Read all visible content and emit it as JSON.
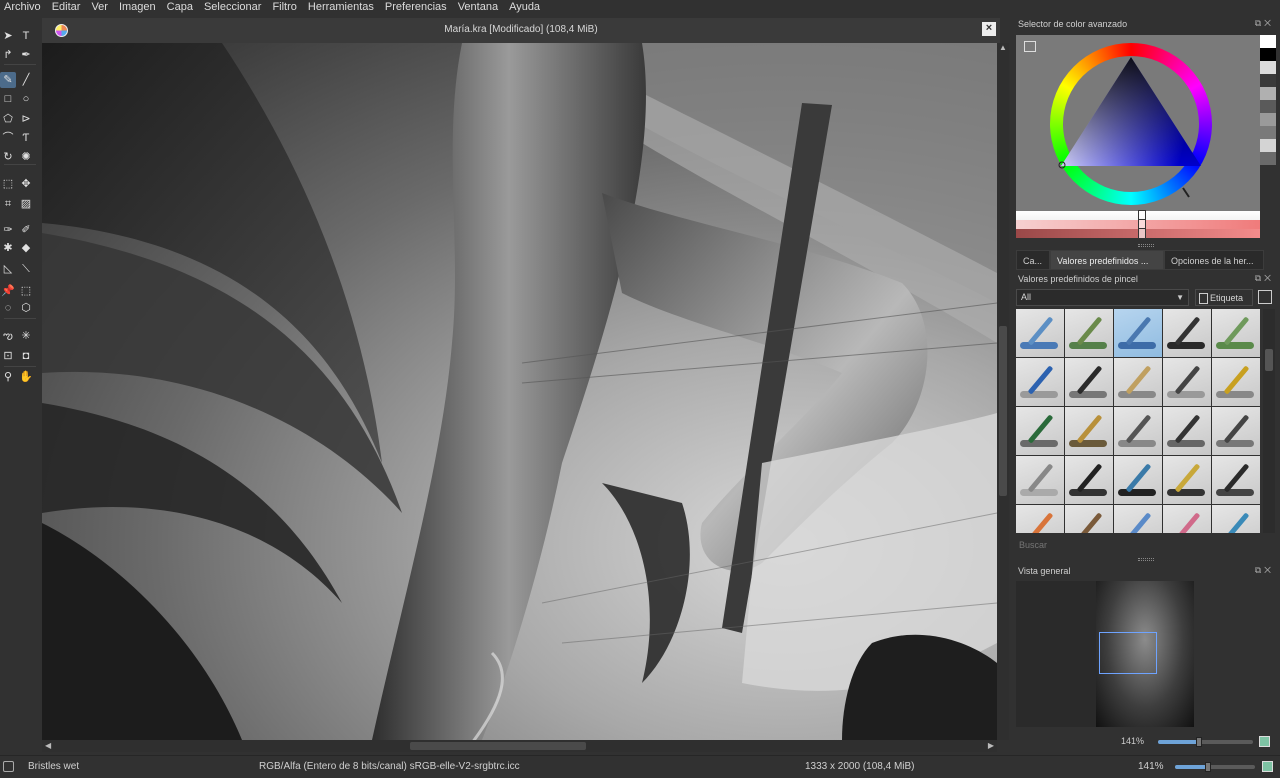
{
  "menu": [
    "Archivo",
    "Editar",
    "Ver",
    "Imagen",
    "Capa",
    "Seleccionar",
    "Filtro",
    "Herramientas",
    "Preferencias",
    "Ventana",
    "Ayuda"
  ],
  "document": {
    "title": "María.kra [Modificado]  (108,4 MiB)",
    "close_label": "×"
  },
  "tools": [
    {
      "name": "select-shape-tool",
      "glyph": "➤"
    },
    {
      "name": "text-tool",
      "glyph": "T"
    },
    {
      "name": "edit-shapes-tool",
      "glyph": "↱"
    },
    {
      "name": "calligraphy-tool",
      "glyph": "✒"
    },
    {
      "name": "freehand-brush-tool",
      "glyph": "✎"
    },
    {
      "name": "line-tool",
      "glyph": "╱"
    },
    {
      "name": "rectangle-tool",
      "glyph": "□"
    },
    {
      "name": "ellipse-tool",
      "glyph": "○"
    },
    {
      "name": "polygon-tool",
      "glyph": "⬠"
    },
    {
      "name": "polyline-tool",
      "glyph": "⊳"
    },
    {
      "name": "bezier-tool",
      "glyph": "⌒"
    },
    {
      "name": "freehand-path-tool",
      "glyph": "Ƭ"
    },
    {
      "name": "dynamic-brush-tool",
      "glyph": "↻"
    },
    {
      "name": "multibrush-tool",
      "glyph": "✺"
    },
    {
      "name": "transform-tool",
      "glyph": "⬚"
    },
    {
      "name": "move-tool",
      "glyph": "✥"
    },
    {
      "name": "crop-tool",
      "glyph": "⌗"
    },
    {
      "name": "gradient-tool",
      "glyph": "▨"
    },
    {
      "name": "color-picker-tool",
      "glyph": "✑"
    },
    {
      "name": "smart-patch-tool",
      "glyph": "✐"
    },
    {
      "name": "fill-tool",
      "glyph": "✱"
    },
    {
      "name": "enclose-fill-tool",
      "glyph": "◆"
    },
    {
      "name": "assistant-tool",
      "glyph": "◺"
    },
    {
      "name": "measure-tool",
      "glyph": "⟍"
    },
    {
      "name": "reference-images-tool",
      "glyph": "📌"
    },
    {
      "name": "rect-select-tool",
      "glyph": "⬚"
    },
    {
      "name": "ellipse-select-tool",
      "glyph": "◌"
    },
    {
      "name": "polygon-select-tool",
      "glyph": "⬡"
    },
    {
      "name": "outline-select-tool",
      "glyph": "ఌ"
    },
    {
      "name": "contiguous-select-tool",
      "glyph": "✳"
    },
    {
      "name": "similar-select-tool",
      "glyph": "⊡"
    },
    {
      "name": "bezier-select-tool",
      "glyph": "◘"
    },
    {
      "name": "zoom-tool",
      "glyph": "⚲"
    },
    {
      "name": "pan-tool",
      "glyph": "✋"
    }
  ],
  "color_panel": {
    "title": "Selector de color avanzado",
    "swatches": [
      "#ffffff",
      "#000000",
      "#dcdcdc",
      "#3a3a3a",
      "#b0b0b0",
      "#5a5a5a",
      "#9a9a9a",
      "#7a7a7a",
      "#d4d4d4",
      "#6a6a6a"
    ]
  },
  "tabs": [
    "Ca...",
    "Valores predefinidos ...",
    "Opciones de la her..."
  ],
  "presets": {
    "title": "Valores predefinidos de pincel",
    "filter_value": "All",
    "tag_label": "Etiqueta",
    "search_placeholder": "Buscar",
    "items": [
      {
        "tip": "#5c8fc4",
        "stroke": "#4a7ab6",
        "selected": false
      },
      {
        "tip": "#6a8a4a",
        "stroke": "#55804a",
        "selected": false
      },
      {
        "tip": "#4a78b0",
        "stroke": "#3d6ca8",
        "selected": true
      },
      {
        "tip": "#333333",
        "stroke": "#2a2a2a",
        "selected": false
      },
      {
        "tip": "#6f9a5c",
        "stroke": "#5a8a4a",
        "selected": false
      },
      {
        "tip": "#2c62b0",
        "stroke": "#9a9a9a",
        "selected": false
      },
      {
        "tip": "#2a2a2a",
        "stroke": "#777777",
        "selected": false
      },
      {
        "tip": "#c0a060",
        "stroke": "#888888",
        "selected": false
      },
      {
        "tip": "#444444",
        "stroke": "#999999",
        "selected": false
      },
      {
        "tip": "#c8a020",
        "stroke": "#888888",
        "selected": false
      },
      {
        "tip": "#2a6a3a",
        "stroke": "#6a6a6a",
        "selected": false
      },
      {
        "tip": "#b8903a",
        "stroke": "#6a5a3a",
        "selected": false
      },
      {
        "tip": "#555555",
        "stroke": "#888888",
        "selected": false
      },
      {
        "tip": "#333333",
        "stroke": "#666666",
        "selected": false
      },
      {
        "tip": "#444444",
        "stroke": "#777777",
        "selected": false
      },
      {
        "tip": "#888888",
        "stroke": "#aaaaaa",
        "selected": false
      },
      {
        "tip": "#222222",
        "stroke": "#333333",
        "selected": false
      },
      {
        "tip": "#3a7aa8",
        "stroke": "#222222",
        "selected": false
      },
      {
        "tip": "#c8a83a",
        "stroke": "#333333",
        "selected": false
      },
      {
        "tip": "#2a2a2a",
        "stroke": "#444444",
        "selected": false
      },
      {
        "tip": "#d8743a",
        "stroke": "#cc6a3a",
        "selected": false
      },
      {
        "tip": "#7a5a3a",
        "stroke": "#666666",
        "selected": false
      },
      {
        "tip": "#5a8ac8",
        "stroke": "#7a9ab8",
        "selected": false
      },
      {
        "tip": "#d06a8a",
        "stroke": "#c07a8a",
        "selected": false
      },
      {
        "tip": "#3a8ab8",
        "stroke": "#4a7aa8",
        "selected": false
      }
    ]
  },
  "overview": {
    "title": "Vista general",
    "zoom": "141%"
  },
  "status": {
    "brush": "Bristles wet",
    "color_space": "RGB/Alfa (Entero de 8 bits/canal)  sRGB-elle-V2-srgbtrc.icc",
    "dimensions": "1333 x 2000 (108,4 MiB)",
    "zoom": "141%"
  }
}
